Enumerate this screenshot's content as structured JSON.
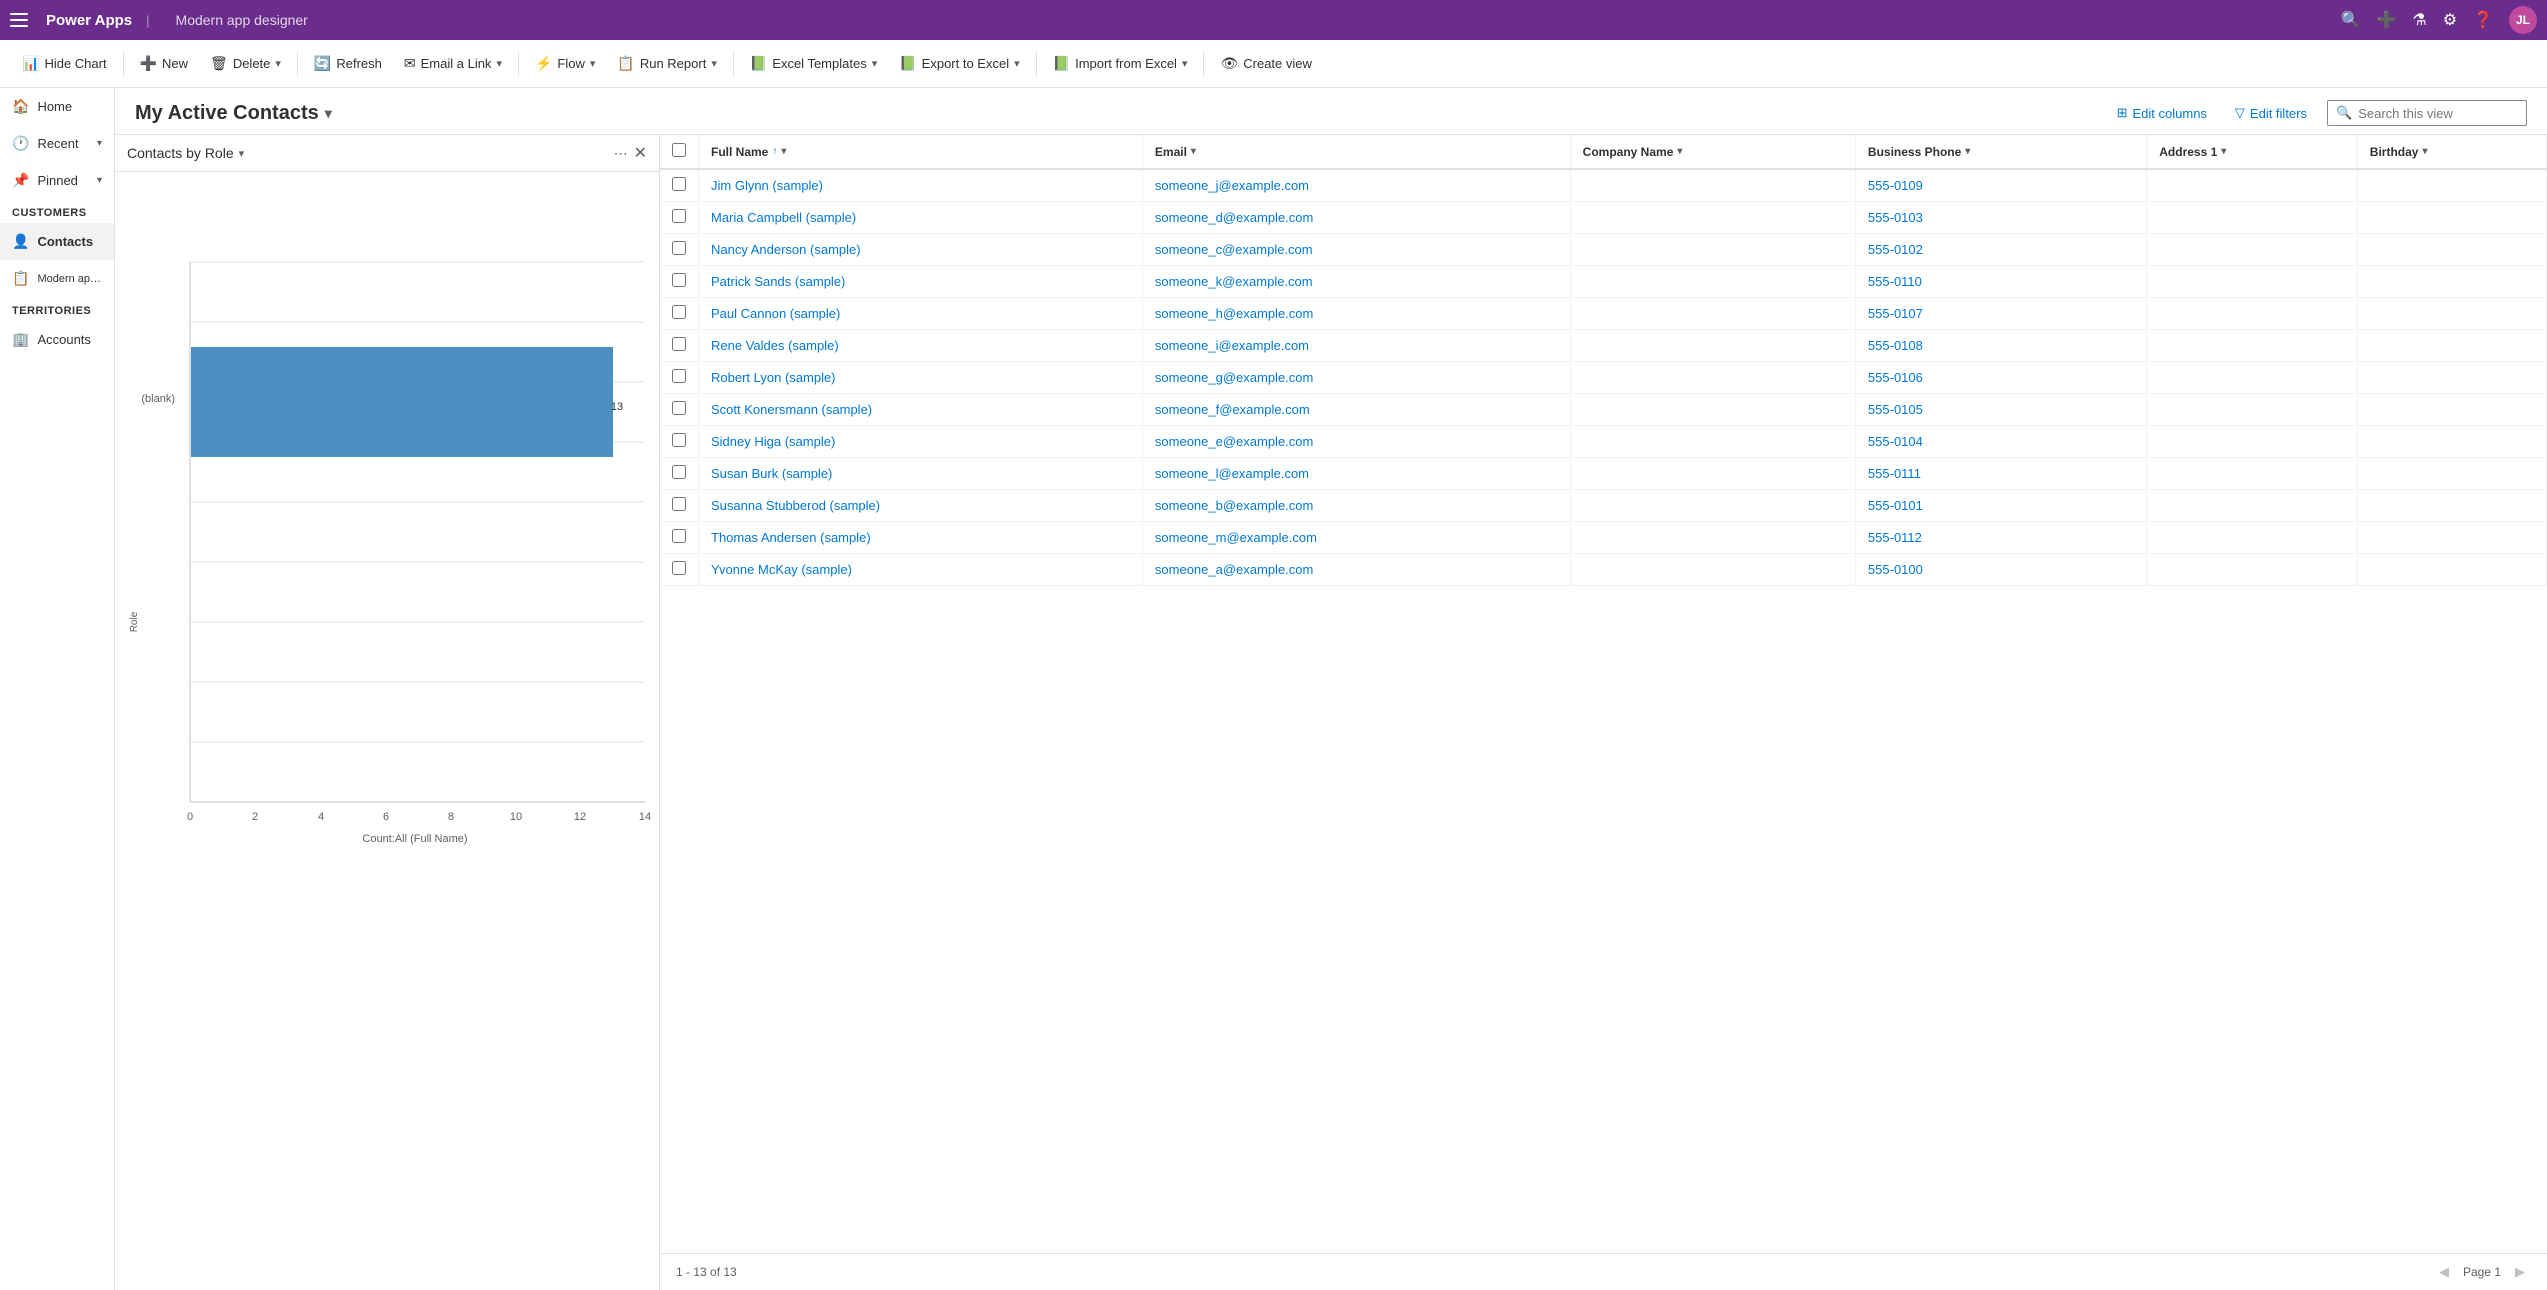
{
  "topBar": {
    "appName": "Power Apps",
    "appTitle": "Modern app designer",
    "avatarInitials": "JL"
  },
  "toolbar": {
    "hideChart": "Hide Chart",
    "new": "New",
    "delete": "Delete",
    "refresh": "Refresh",
    "emailALink": "Email a Link",
    "flow": "Flow",
    "runReport": "Run Report",
    "excelTemplates": "Excel Templates",
    "exportToExcel": "Export to Excel",
    "importFromExcel": "Import from Excel",
    "createView": "Create view"
  },
  "viewHeader": {
    "title": "My Active Contacts",
    "editColumns": "Edit columns",
    "editFilters": "Edit filters",
    "searchPlaceholder": "Search this view"
  },
  "sidebar": {
    "items": [
      {
        "label": "Home",
        "icon": "🏠"
      },
      {
        "label": "Recent",
        "icon": "🕐",
        "hasArrow": true
      },
      {
        "label": "Pinned",
        "icon": "📌",
        "hasArrow": true
      }
    ],
    "customers": {
      "label": "Customers",
      "items": [
        {
          "label": "Contacts",
          "icon": "👤"
        },
        {
          "label": "Modern app designe...",
          "icon": "📋"
        }
      ]
    },
    "territories": {
      "label": "Territories",
      "items": [
        {
          "label": "Accounts",
          "icon": "🏢"
        }
      ]
    }
  },
  "chart": {
    "title": "Contacts by Role",
    "blankLabel": "(blank)",
    "roleLabel": "Role",
    "countLabel": "Count:All (Full Name)",
    "barValue": 13,
    "axisMax": 14,
    "axisValues": [
      "0",
      "2",
      "4",
      "6",
      "8",
      "10",
      "12",
      "14"
    ],
    "barColor": "#4e8fc1"
  },
  "table": {
    "columns": [
      {
        "key": "fullName",
        "label": "Full Name",
        "sorted": true,
        "sortDir": "asc"
      },
      {
        "key": "email",
        "label": "Email"
      },
      {
        "key": "companyName",
        "label": "Company Name"
      },
      {
        "key": "businessPhone",
        "label": "Business Phone"
      },
      {
        "key": "address1",
        "label": "Address 1"
      },
      {
        "key": "birthday",
        "label": "Birthday"
      }
    ],
    "rows": [
      {
        "fullName": "Jim Glynn (sample)",
        "email": "someone_j@example.com",
        "companyName": "",
        "businessPhone": "555-0109",
        "address1": "",
        "birthday": ""
      },
      {
        "fullName": "Maria Campbell (sample)",
        "email": "someone_d@example.com",
        "companyName": "",
        "businessPhone": "555-0103",
        "address1": "",
        "birthday": ""
      },
      {
        "fullName": "Nancy Anderson (sample)",
        "email": "someone_c@example.com",
        "companyName": "",
        "businessPhone": "555-0102",
        "address1": "",
        "birthday": ""
      },
      {
        "fullName": "Patrick Sands (sample)",
        "email": "someone_k@example.com",
        "companyName": "",
        "businessPhone": "555-0110",
        "address1": "",
        "birthday": ""
      },
      {
        "fullName": "Paul Cannon (sample)",
        "email": "someone_h@example.com",
        "companyName": "",
        "businessPhone": "555-0107",
        "address1": "",
        "birthday": ""
      },
      {
        "fullName": "Rene Valdes (sample)",
        "email": "someone_i@example.com",
        "companyName": "",
        "businessPhone": "555-0108",
        "address1": "",
        "birthday": ""
      },
      {
        "fullName": "Robert Lyon (sample)",
        "email": "someone_g@example.com",
        "companyName": "",
        "businessPhone": "555-0106",
        "address1": "",
        "birthday": ""
      },
      {
        "fullName": "Scott Konersmann (sample)",
        "email": "someone_f@example.com",
        "companyName": "",
        "businessPhone": "555-0105",
        "address1": "",
        "birthday": ""
      },
      {
        "fullName": "Sidney Higa (sample)",
        "email": "someone_e@example.com",
        "companyName": "",
        "businessPhone": "555-0104",
        "address1": "",
        "birthday": ""
      },
      {
        "fullName": "Susan Burk (sample)",
        "email": "someone_l@example.com",
        "companyName": "",
        "businessPhone": "555-0111",
        "address1": "",
        "birthday": ""
      },
      {
        "fullName": "Susanna Stubberod (sample)",
        "email": "someone_b@example.com",
        "companyName": "",
        "businessPhone": "555-0101",
        "address1": "",
        "birthday": ""
      },
      {
        "fullName": "Thomas Andersen (sample)",
        "email": "someone_m@example.com",
        "companyName": "",
        "businessPhone": "555-0112",
        "address1": "",
        "birthday": ""
      },
      {
        "fullName": "Yvonne McKay (sample)",
        "email": "someone_a@example.com",
        "companyName": "",
        "businessPhone": "555-0100",
        "address1": "",
        "birthday": ""
      }
    ],
    "footer": {
      "recordCount": "1 - 13 of 13",
      "pageLabel": "Page 1"
    }
  }
}
